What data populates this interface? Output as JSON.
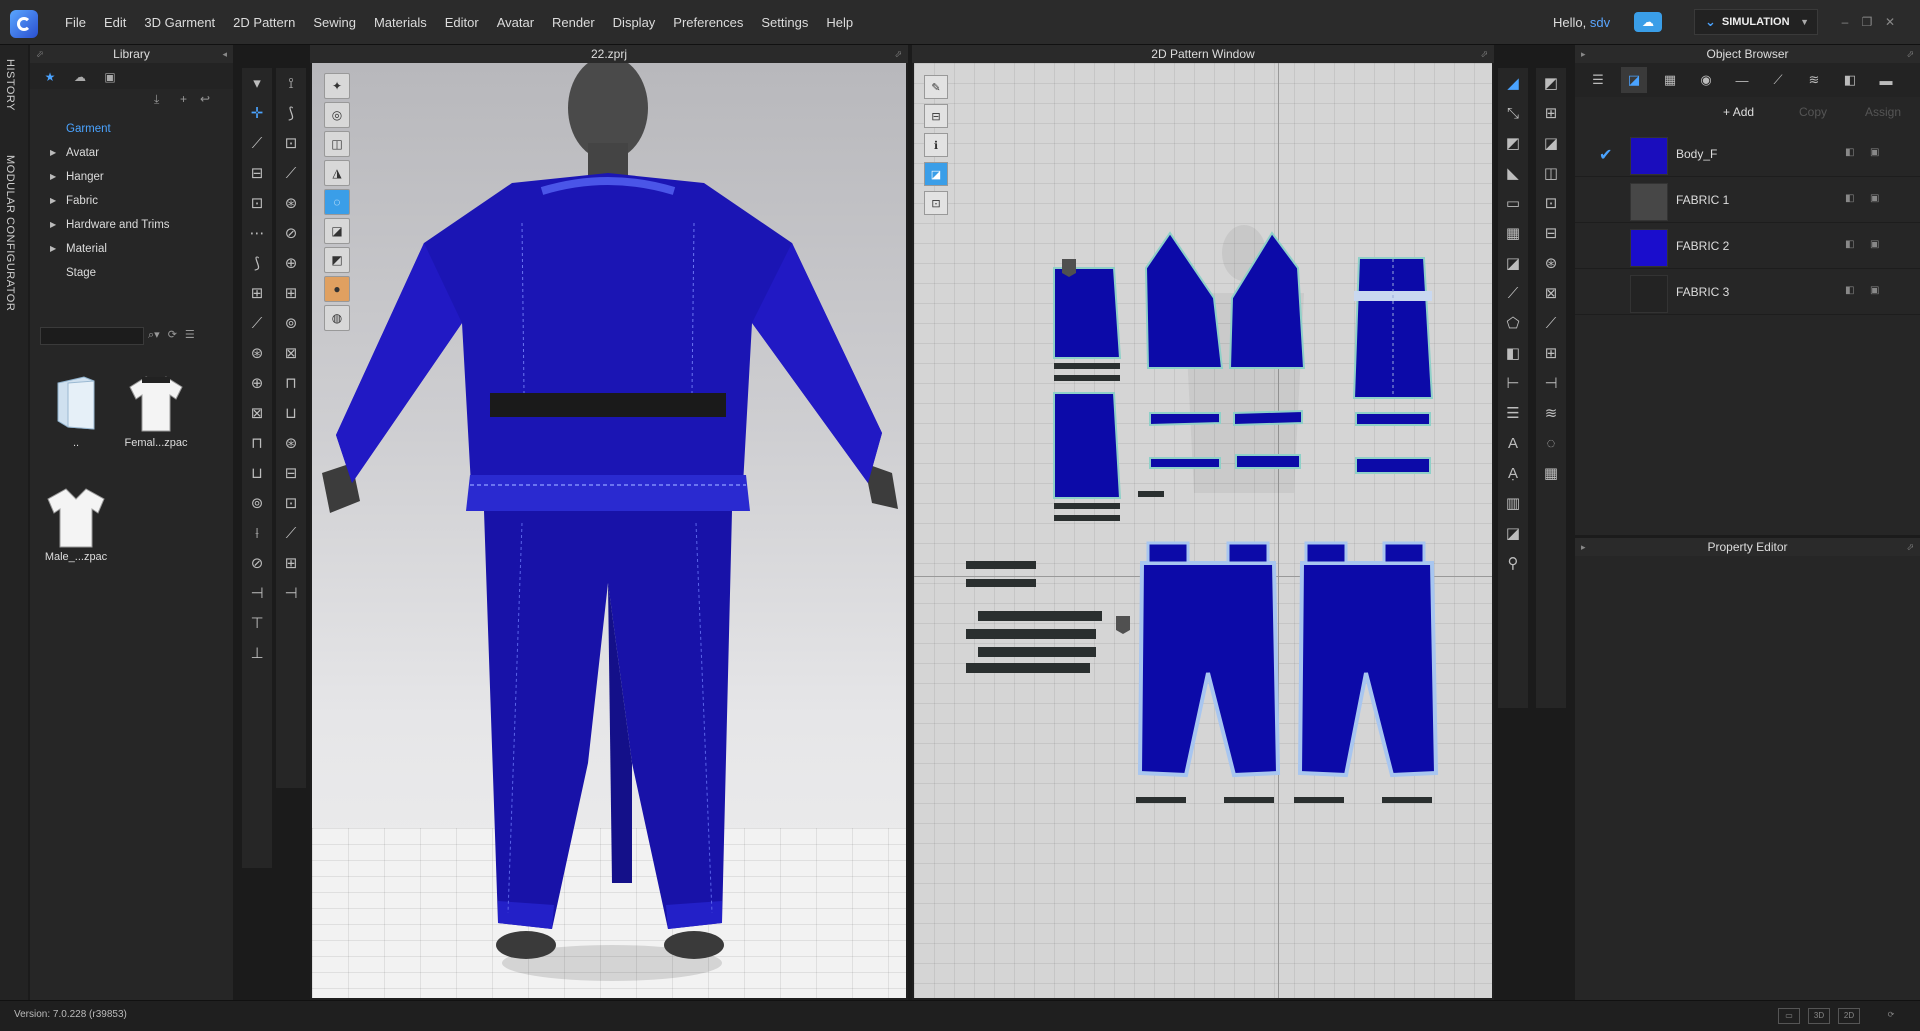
{
  "menubar": {
    "items": [
      "File",
      "Edit",
      "3D Garment",
      "2D Pattern",
      "Sewing",
      "Materials",
      "Editor",
      "Avatar",
      "Render",
      "Display",
      "Preferences",
      "Settings",
      "Help"
    ],
    "greeting_prefix": "Hello, ",
    "username": "sdv",
    "mode_label": "SIMULATION"
  },
  "side_tabs": {
    "history": "HISTORY",
    "modular": "MODULAR CONFIGURATOR"
  },
  "library": {
    "title": "Library",
    "tree": [
      "Garment",
      "Avatar",
      "Hanger",
      "Fabric",
      "Hardware and Trims",
      "Material",
      "Stage"
    ],
    "selected": "Garment",
    "thumbs": [
      "..",
      "Femal...zpac",
      "Male_...zpac"
    ]
  },
  "view3d": {
    "title": "22.zprj"
  },
  "view2d": {
    "title": "2D Pattern Window"
  },
  "object_browser": {
    "title": "Object Browser",
    "add_label": "Add",
    "copy_label": "Copy",
    "assign_label": "Assign",
    "fabrics": [
      {
        "name": "Body_F",
        "color": "#1a0dbd",
        "checked": true
      },
      {
        "name": "FABRIC 1",
        "color": "#474747",
        "checked": false
      },
      {
        "name": "FABRIC 2",
        "color": "#1a0dcc",
        "checked": false
      },
      {
        "name": "FABRIC 3",
        "color": "#232323",
        "checked": false
      }
    ]
  },
  "property_editor": {
    "title": "Property Editor"
  },
  "status": {
    "version": "Version: 7.0.228 (r39853)"
  },
  "colors": {
    "accent": "#4aa3ff",
    "garment": "#1a12b8",
    "pattern_piece": "#0c0aa8"
  },
  "icons": [
    "app-logo-icon",
    "cloud-icon",
    "star-icon",
    "search-icon",
    "refresh-icon",
    "list-icon",
    "plus-icon",
    "check-icon"
  ]
}
